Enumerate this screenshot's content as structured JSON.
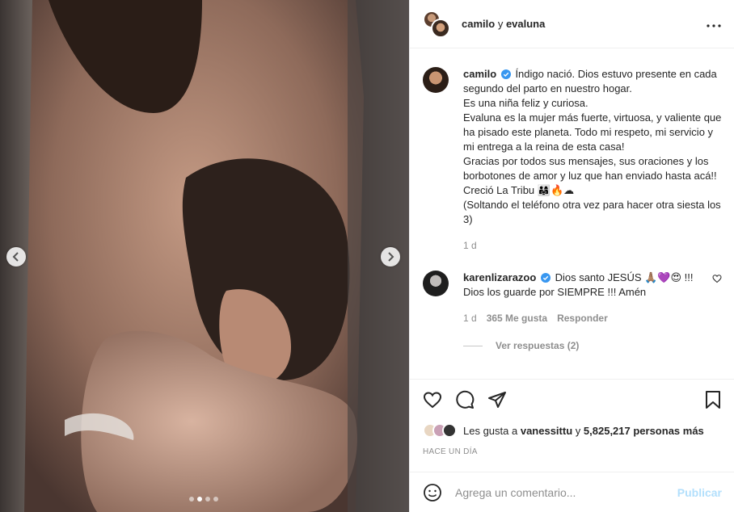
{
  "header": {
    "user1": "camilo",
    "separator": "y",
    "user2": "evaluna",
    "more_icon": "more-horizontal-icon"
  },
  "caption": {
    "username": "camilo",
    "text": "Índigo nació. Dios estuvo presente en cada segundo del parto en nuestro hogar.\nEs una niña feliz y curiosa.\nEvaluna es la mujer más fuerte, virtuosa, y valiente que ha pisado este planeta. Todo mi respeto, mi servicio y mi entrega a la reina de esta casa!\nGracias por todos sus mensajes, sus oraciones y los borbotones de amor y luz que han enviado hasta acá!!\nCreció La Tribu 👨‍👩‍👧🔥☁\n(Soltando el teléfono otra vez para hacer otra siesta los 3)",
    "time": "1 d"
  },
  "comment": {
    "username": "karenlizarazoo",
    "text": "Dios santo JESÚS 🙏🏽💜😍 !!! Dios los guarde por SIEMPRE !!! Amén",
    "time": "1 d",
    "likes": "365 Me gusta",
    "reply": "Responder",
    "view_replies": "Ver respuestas (2)"
  },
  "likes": {
    "prefix": "Les gusta a",
    "user": "vanessittu",
    "connector": "y",
    "count": "5,825,217 personas más"
  },
  "date": "HACE UN DÍA",
  "add_comment": {
    "placeholder": "Agrega un comentario...",
    "publish": "Publicar"
  },
  "carousel": {
    "total": 4,
    "active": 2
  },
  "colors": {
    "verified": "#3897f0",
    "link": "#0095f6",
    "muted": "#8e8e8e"
  }
}
